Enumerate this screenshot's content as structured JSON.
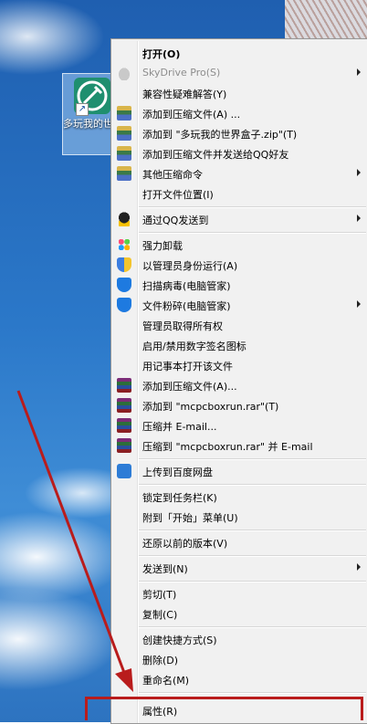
{
  "desktop": {
    "icon_label": "多玩我的世界盒子"
  },
  "context_menu": {
    "items": [
      {
        "label": "打开(O)",
        "icon": "none",
        "bold": true
      },
      {
        "label": "SkyDrive Pro(S)",
        "icon": "cloud-icon",
        "disabled": true,
        "submenu": true
      },
      {
        "label": "兼容性疑难解答(Y)",
        "icon": "none"
      },
      {
        "label": "添加到压缩文件(A) ...",
        "icon": "archive-icon"
      },
      {
        "label": "添加到 \"多玩我的世界盒子.zip\"(T)",
        "icon": "archive-icon"
      },
      {
        "label": "添加到压缩文件并发送给QQ好友",
        "icon": "archive-icon"
      },
      {
        "label": "其他压缩命令",
        "icon": "archive-icon",
        "submenu": true
      },
      {
        "label": "打开文件位置(I)",
        "icon": "none"
      },
      {
        "label": "通过QQ发送到",
        "icon": "qq-icon",
        "submenu": true
      },
      {
        "label": "强力卸载",
        "icon": "flower-icon"
      },
      {
        "label": "以管理员身份运行(A)",
        "icon": "uac-shield-icon"
      },
      {
        "label": "扫描病毒(电脑管家)",
        "icon": "shield-icon"
      },
      {
        "label": "文件粉碎(电脑管家)",
        "icon": "shield-icon",
        "submenu": true
      },
      {
        "label": "管理员取得所有权",
        "icon": "none"
      },
      {
        "label": "启用/禁用数字签名图标",
        "icon": "none"
      },
      {
        "label": "用记事本打开该文件",
        "icon": "none"
      },
      {
        "label": "添加到压缩文件(A)...",
        "icon": "winrar-icon"
      },
      {
        "label": "添加到 \"mcpcboxrun.rar\"(T)",
        "icon": "winrar-icon"
      },
      {
        "label": "压缩并 E-mail...",
        "icon": "winrar-icon"
      },
      {
        "label": "压缩到 \"mcpcboxrun.rar\" 并 E-mail",
        "icon": "winrar-icon"
      },
      {
        "label": "上传到百度网盘",
        "icon": "baidu-cloud-icon"
      },
      {
        "label": "锁定到任务栏(K)",
        "icon": "none"
      },
      {
        "label": "附到「开始」菜单(U)",
        "icon": "none"
      },
      {
        "label": "还原以前的版本(V)",
        "icon": "none"
      },
      {
        "label": "发送到(N)",
        "icon": "none",
        "submenu": true
      },
      {
        "label": "剪切(T)",
        "icon": "none"
      },
      {
        "label": "复制(C)",
        "icon": "none"
      },
      {
        "label": "创建快捷方式(S)",
        "icon": "none"
      },
      {
        "label": "删除(D)",
        "icon": "none"
      },
      {
        "label": "重命名(M)",
        "icon": "none"
      },
      {
        "label": "属性(R)",
        "icon": "none"
      }
    ]
  },
  "annotation": {
    "color": "#b91c1c",
    "highlighted_item": "属性(R)"
  }
}
